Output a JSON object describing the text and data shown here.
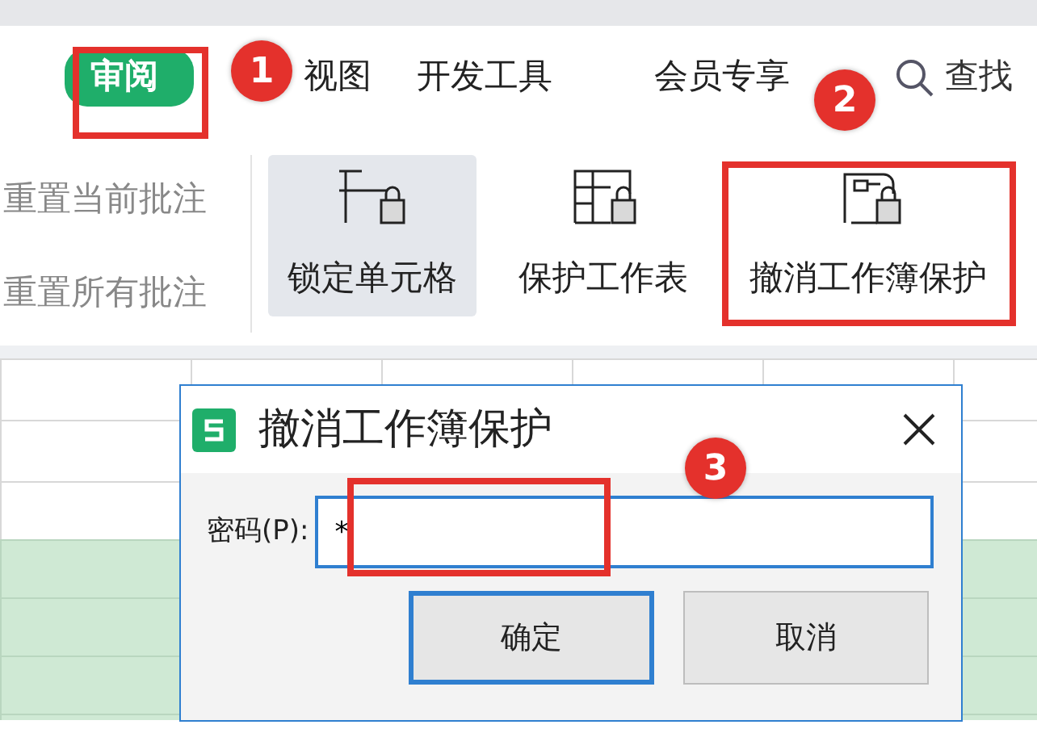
{
  "tabs": [
    {
      "label": "审阅",
      "selected": true
    },
    {
      "label": "视图",
      "selected": false
    },
    {
      "label": "开发工具",
      "selected": false
    },
    {
      "label": "会员专享",
      "selected": false
    }
  ],
  "search": {
    "label": "查找"
  },
  "ribbon": {
    "left_items": [
      "重置当前批注",
      "重置所有批注"
    ],
    "buttons": [
      {
        "label": "锁定单元格",
        "kind": "lock-cells",
        "selected": true
      },
      {
        "label": "保护工作表",
        "kind": "protect-sheet",
        "selected": false
      },
      {
        "label": "撤消工作簿保护",
        "kind": "unprotect-workbook",
        "selected": false
      }
    ]
  },
  "dialog": {
    "title": "撤消工作簿保护",
    "password_label": "密码(P):",
    "password_value": "*",
    "buttons": [
      {
        "label": "确定",
        "selected": true
      },
      {
        "label": "取消",
        "selected": false
      }
    ]
  },
  "annotations": [
    {
      "label": "1"
    },
    {
      "label": "2"
    },
    {
      "label": "3"
    }
  ]
}
